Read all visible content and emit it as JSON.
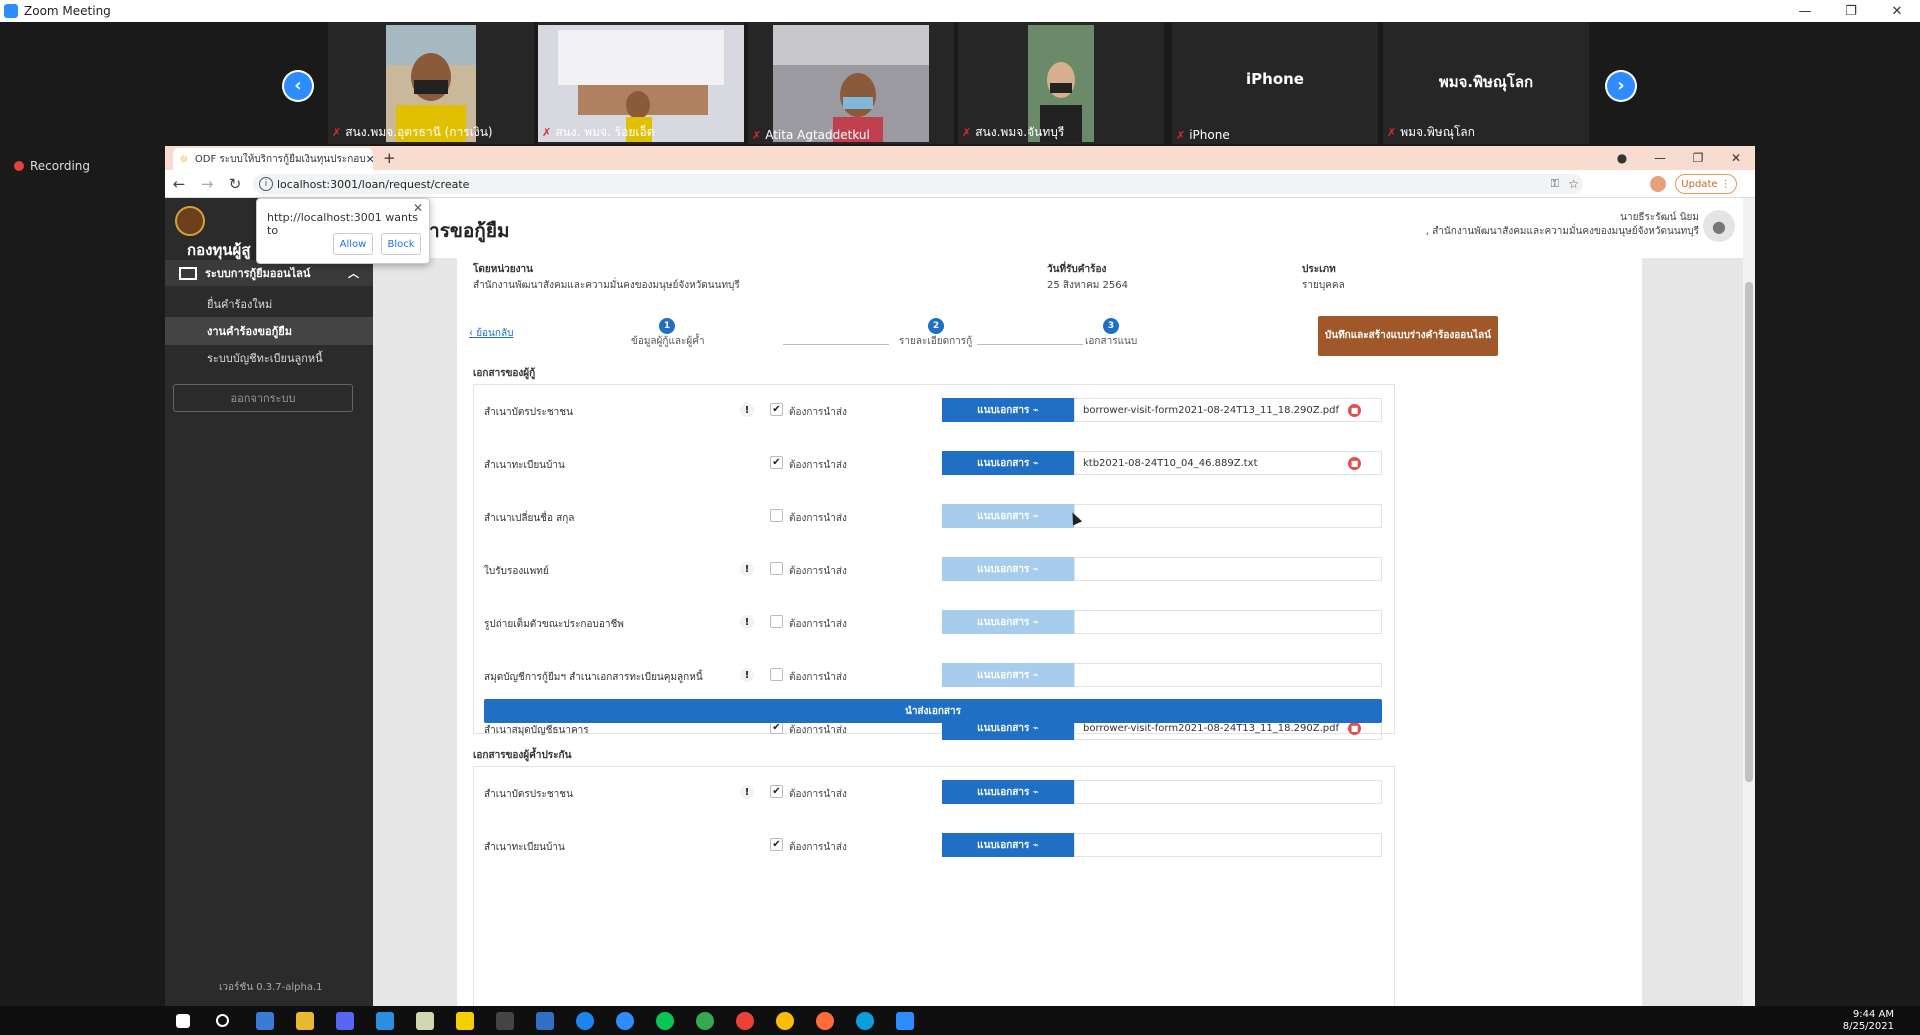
{
  "zoom": {
    "title": "Zoom Meeting",
    "recording_label": "Recording",
    "participants": [
      {
        "name": "สนง.พมจ.อุตรธานี (การเงิน)",
        "video": true
      },
      {
        "name": "สนง. พมจ. ร้อยเอ็ด",
        "video": true
      },
      {
        "name": "Atita Agtaddetkul",
        "video": true
      },
      {
        "name": "สนง.พมจ.จันทบุรี",
        "video": true
      },
      {
        "name": "iPhone",
        "video": false,
        "display": "iPhone"
      },
      {
        "name": "พมจ.พิษณุโลก",
        "video": false,
        "display": "พมจ.พิษณุโลก"
      }
    ]
  },
  "browser": {
    "tab_title": "ODF ระบบให้บริการกู้ยืมเงินทุนประกอบ",
    "url": "localhost:3001/loan/request/create",
    "update_label": "Update",
    "permission": {
      "text": "http://localhost:3001 wants to",
      "allow": "Allow",
      "block": "Block"
    }
  },
  "sidebar": {
    "org_name": "กองทุนผู้สู",
    "menu_head": "ระบบการกู้ยืมออนไลน์",
    "items": [
      {
        "label": "ยื่นคำร้องใหม่",
        "active": false
      },
      {
        "label": "งานคำร้องขอกู้ยืม",
        "active": true
      },
      {
        "label": "ระบบบัญชีทะเบียนลูกหนี้",
        "active": false
      }
    ],
    "logout": "ออกจากระบบ",
    "version": "เวอร์ชัน 0.3.7-alpha.1"
  },
  "header": {
    "page_title": "ระบบการขอกู้ยืม",
    "user_name": "นายธีระรัฒน์ นิยม",
    "user_org": ", สำนักงานพัฒนาสังคมและความมั่นคงของมนุษย์จังหวัดนนทบุรี"
  },
  "request_info": {
    "unit_label": "โดยหน่วยงาน",
    "unit_value": "สำนักงานพัฒนาสังคมและความมั่นคงของมนุษย์จังหวัดนนทบุรี",
    "date_label": "วันที่รับคำร้อง",
    "date_value": "25 สิงหาคม 2564",
    "type_label": "ประเภท",
    "type_value": "รายบุคคล"
  },
  "steps": {
    "back": "ย้อนกลับ",
    "items": [
      {
        "num": "1",
        "label": "ข้อมูลผู้กู้และผู้ค้ำ"
      },
      {
        "num": "2",
        "label": "รายละเอียดการกู้"
      },
      {
        "num": "3",
        "label": "เอกสารแนบ"
      }
    ],
    "save_button": "บันทึกและสร้างแบบร่างคำร้องออนไลน์"
  },
  "borrower_docs": {
    "title": "เอกสารของผู้กู้",
    "required_label": "ต้องการนำส่ง",
    "attach_label": "แนบเอกสาร",
    "submit_label": "นำส่งเอกสาร",
    "rows": [
      {
        "name": "สำเนาบัตรประชาชน",
        "warn": true,
        "checked": true,
        "enabled": true,
        "file": "borrower-visit-form2021-08-24T13_11_18.290Z.pdf"
      },
      {
        "name": "สำเนาทะเบียนบ้าน",
        "warn": false,
        "checked": true,
        "enabled": true,
        "file": "ktb2021-08-24T10_04_46.889Z.txt"
      },
      {
        "name": "สำเนาเปลี่ยนชื่อ สกุล",
        "warn": false,
        "checked": false,
        "enabled": false,
        "file": ""
      },
      {
        "name": "ใบรับรองแพทย์",
        "warn": true,
        "checked": false,
        "enabled": false,
        "file": ""
      },
      {
        "name": "รูปถ่ายเต็มตัวขณะประกอบอาชีพ",
        "warn": true,
        "checked": false,
        "enabled": false,
        "file": ""
      },
      {
        "name": "สมุดบัญชีการกู้ยืมฯ สำเนาเอกสารทะเบียนคุมลูกหนี้",
        "warn": true,
        "checked": false,
        "enabled": false,
        "file": ""
      },
      {
        "name": "สำเนาสมุดบัญชีธนาคาร",
        "warn": false,
        "checked": true,
        "enabled": true,
        "file": "borrower-visit-form2021-08-24T13_11_18.290Z.pdf"
      }
    ]
  },
  "guarantor_docs": {
    "title": "เอกสารของผู้ค้ำประกัน",
    "rows": [
      {
        "name": "สำเนาบัตรประชาชน",
        "warn": true,
        "checked": true,
        "enabled": true,
        "file": ""
      },
      {
        "name": "สำเนาทะเบียนบ้าน",
        "warn": false,
        "checked": true,
        "enabled": true,
        "file": ""
      }
    ]
  },
  "taskbar": {
    "time": "9:44 AM",
    "date": "8/25/2021"
  },
  "colors": {
    "primary": "#1f6fc4",
    "primary_disabled": "#a8cdec",
    "save_button": "#a0582a",
    "sidebar": "#2b2b2b",
    "zoom_blue": "#2d8cff"
  }
}
